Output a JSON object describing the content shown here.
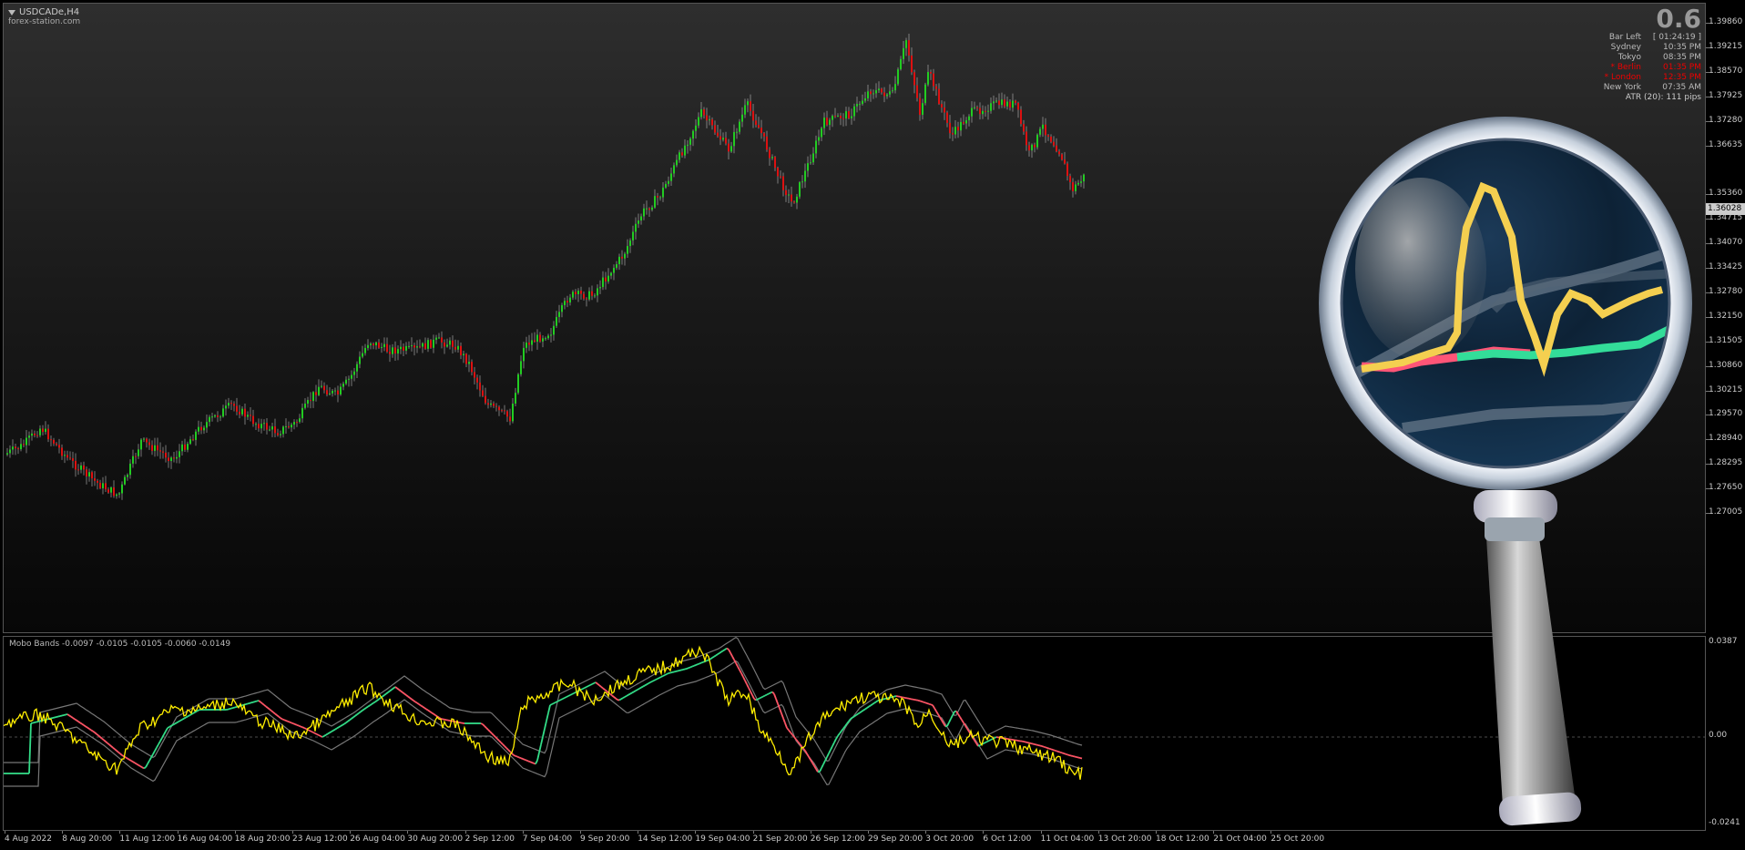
{
  "window": {
    "symbol": "USDCADe,H4",
    "site": "forex-station.com"
  },
  "info_panel": {
    "big_value": "0.6",
    "rows": [
      {
        "label": "Bar Left",
        "value": "[ 01:24:19 ]",
        "highlight": false
      },
      {
        "label": "Sydney",
        "value": "10:35 PM",
        "highlight": false
      },
      {
        "label": "Tokyo",
        "value": "08:35 PM",
        "highlight": false
      },
      {
        "label": "* Berlin",
        "value": "01:35 PM",
        "highlight": true
      },
      {
        "label": "* London",
        "value": "12:35 PM",
        "highlight": true
      },
      {
        "label": "New York",
        "value": "07:35 AM",
        "highlight": false
      }
    ],
    "atr": "ATR (20): 111 pips"
  },
  "price_axis": {
    "labels": [
      "1.39860",
      "1.39215",
      "1.38570",
      "1.37925",
      "1.37280",
      "1.36635",
      "1.35360",
      "1.34715",
      "1.34070",
      "1.33425",
      "1.32780",
      "1.32150",
      "1.31505",
      "1.30860",
      "1.30215",
      "1.29570",
      "1.28940",
      "1.28295",
      "1.27650",
      "1.27005"
    ],
    "current_price": "1.36028"
  },
  "indicator": {
    "title": "Mobo Bands -0.0097 -0.0105 -0.0105 -0.0060 -0.0149",
    "axis_labels": [
      "0.0387",
      "0.00",
      "-0.0241"
    ]
  },
  "time_axis": {
    "labels": [
      "4 Aug 2022",
      "8 Aug 20:00",
      "11 Aug 12:00",
      "16 Aug 04:00",
      "18 Aug 20:00",
      "23 Aug 12:00",
      "26 Aug 04:00",
      "30 Aug 20:00",
      "2 Sep 12:00",
      "7 Sep 04:00",
      "9 Sep 20:00",
      "14 Sep 12:00",
      "19 Sep 04:00",
      "21 Sep 20:00",
      "26 Sep 12:00",
      "29 Sep 20:00",
      "3 Oct 20:00",
      "6 Oct 12:00",
      "11 Oct 04:00",
      "13 Oct 20:00",
      "18 Oct 12:00",
      "21 Oct 04:00",
      "25 Oct 20:00"
    ]
  },
  "colors": {
    "bull": "#22cc22",
    "bear": "#dd1111",
    "wick": "#bbbbbb",
    "osc": "#ffee00",
    "band": "#777777",
    "mid_up": "#33dd88",
    "mid_down": "#ff5566"
  },
  "icons": {
    "magnifier": "magnifying-glass-icon",
    "collapse": "triangle-down-icon"
  }
}
